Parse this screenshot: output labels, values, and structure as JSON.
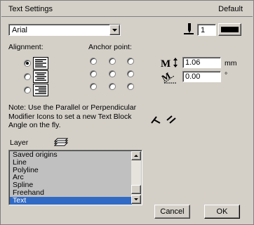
{
  "window": {
    "title": "Text Settings",
    "right_label": "Default"
  },
  "font": {
    "selected": "Arial"
  },
  "line_weight": {
    "value": "1"
  },
  "alignment": {
    "label": "Alignment:",
    "options": [
      "left",
      "center",
      "right"
    ],
    "selected": 0
  },
  "anchor": {
    "label": "Anchor point:",
    "selected": null
  },
  "size": {
    "value": "1.06",
    "unit": "mm"
  },
  "angle": {
    "value": "0.00",
    "unit": "°"
  },
  "note": {
    "text": "Note: Use the Parallel or Perpendicular Modifier Icons to set a new Text Block Angle on the fly."
  },
  "layer": {
    "label": "Layer",
    "items": [
      "Saved origins",
      "Line",
      "Polyline",
      "Arc",
      "Spline",
      "Freehand",
      "Text"
    ],
    "selected_index": 6
  },
  "buttons": {
    "cancel": "Cancel",
    "ok": "OK"
  },
  "icons": {
    "pen": "pen-icon",
    "line_style": "line-style-icon",
    "size": "text-size-icon",
    "angle": "text-angle-icon",
    "parallel": "parallel-modifier-icon",
    "perpendicular": "perpendicular-modifier-icon",
    "layer": "layer-icon"
  },
  "colors": {
    "face": "#d4d0c8",
    "selection": "#316ac5",
    "list_bg": "#c0c0c0"
  }
}
